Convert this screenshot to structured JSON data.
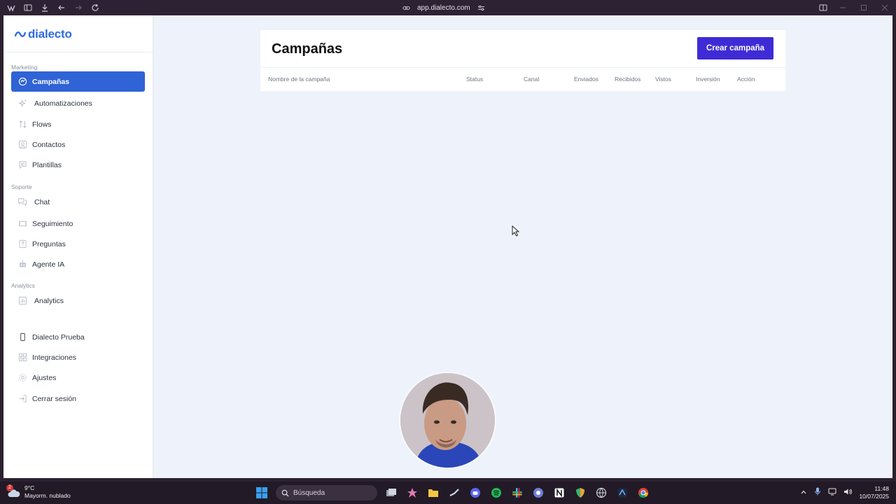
{
  "browser": {
    "url": "app.dialecto.com"
  },
  "sidebar": {
    "logo_text": "dialecto",
    "sections": {
      "marketing": "Marketing",
      "soporte": "Soporte",
      "analytics": "Analytics"
    },
    "items": {
      "campanas": "Campañas",
      "automatizaciones": "Automatizaciones",
      "flows": "Flows",
      "contactos": "Contactos",
      "plantillas": "Plantillas",
      "chat": "Chat",
      "seguimiento": "Seguimiento",
      "preguntas": "Preguntas",
      "agente_ia": "Agente IA",
      "analytics": "Analytics",
      "dialecto_prueba": "Dialecto Prueba",
      "integraciones": "Integraciones",
      "ajustes": "Ajustes",
      "cerrar_sesion": "Cerrar sesión"
    }
  },
  "main": {
    "title": "Campañas",
    "create_button": "Crear campaña",
    "columns": [
      "Nombre de la campaña",
      "Status",
      "Canal",
      "Enviados",
      "Recibidos",
      "Vistos",
      "Inversión",
      "Acción"
    ]
  },
  "taskbar": {
    "weather_badge": "2",
    "temperature": "9°C",
    "weather_desc": "Mayorm. nublado",
    "search_placeholder": "Búsqueda",
    "time": "11:48",
    "date": "10/07/2025"
  },
  "colors": {
    "accent_blue": "#2f63d6",
    "create_button": "#3f2bd6",
    "background": "#eef3fb"
  }
}
